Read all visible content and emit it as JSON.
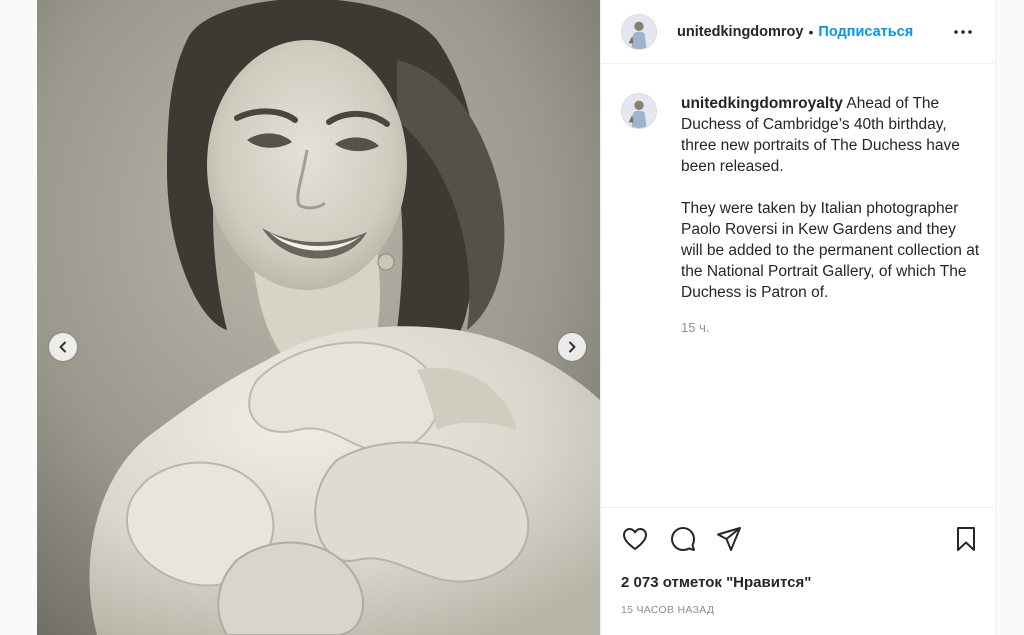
{
  "header": {
    "username": "unitedkingdomroy",
    "separator": "•",
    "follow_label": "Подписаться",
    "more_icon": "more-horizontal-icon"
  },
  "caption": {
    "username": "unitedkingdomroyalty",
    "paragraph1": "Ahead of The Duchess of Cambridge’s 40th birthday, three new portraits of The Duchess have been released.",
    "paragraph2": "They were taken by Italian photographer Paolo Roversi in Kew Gardens and they will be added to the permanent collection at the National Portrait Gallery, of which The Duchess is Patron of.",
    "time_ago": "15 ч."
  },
  "actions": {
    "like_icon": "heart-icon",
    "comment_icon": "comment-icon",
    "share_icon": "paper-plane-icon",
    "save_icon": "bookmark-icon"
  },
  "likes": "2 073 отметок \"Нравится\"",
  "posted": "15 ЧАСОВ НАЗАД",
  "carousel": {
    "prev_icon": "chevron-left-icon",
    "next_icon": "chevron-right-icon"
  },
  "colors": {
    "link_blue": "#0095f6",
    "text": "#262626",
    "secondary": "#8e8e8e",
    "divider": "#efefef"
  }
}
